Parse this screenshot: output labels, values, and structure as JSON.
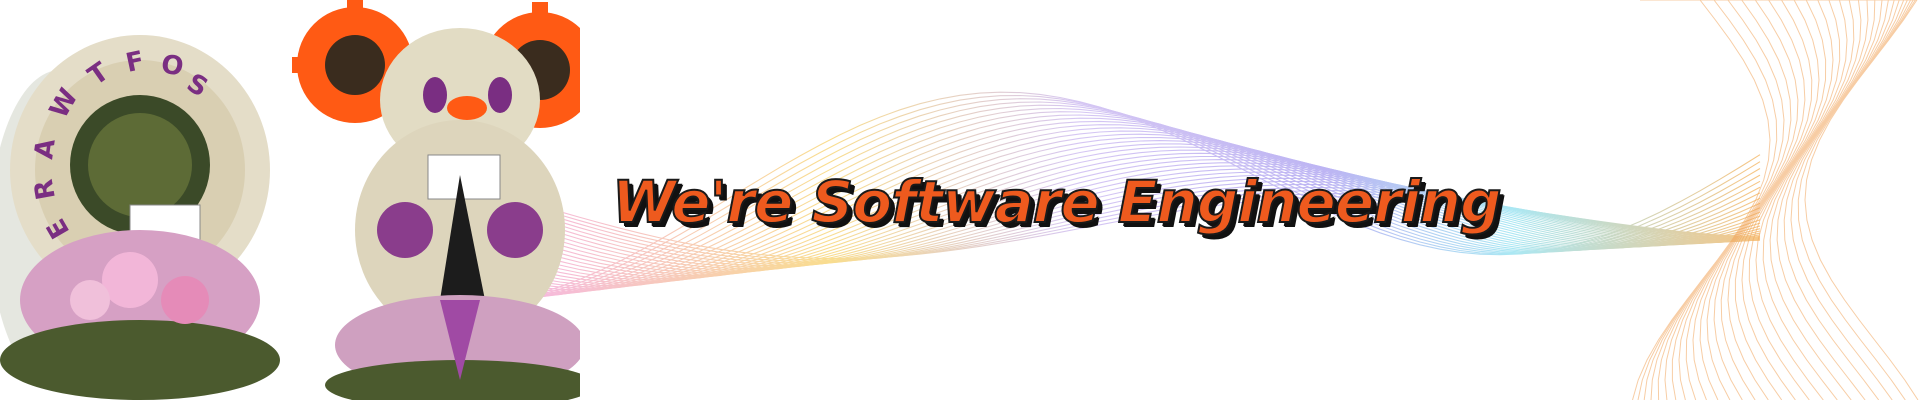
{
  "banner": {
    "headline": "We're Software Engineering",
    "decor_lettering": "SOFTWARE",
    "colors": {
      "headline_fill": "#ee5a1e",
      "headline_shadow": "#111111",
      "gear": "#ff5a14",
      "ribbon_palette": [
        "#f3a0d8",
        "#f7d26a",
        "#b59cf0",
        "#8fe0f0",
        "#f5b25a"
      ]
    }
  }
}
